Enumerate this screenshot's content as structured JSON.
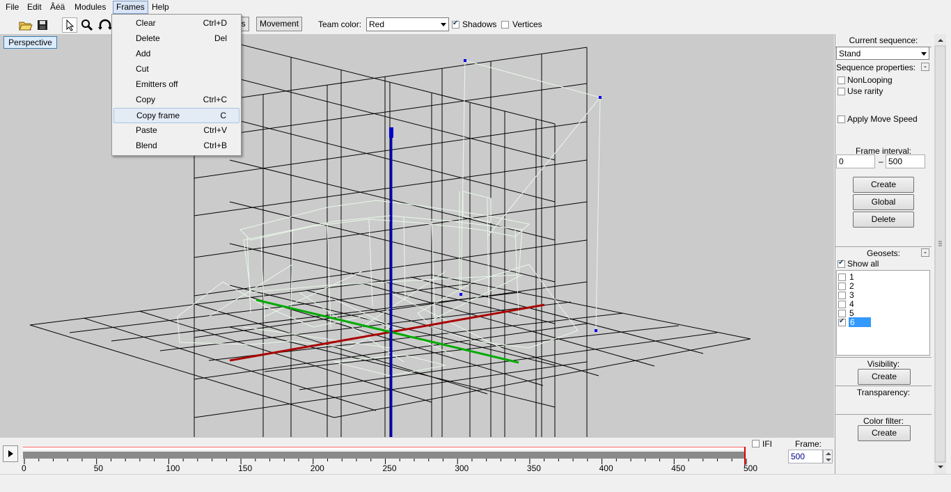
{
  "menubar": {
    "items": [
      "File",
      "Edit",
      "Âéä",
      "Modules",
      "Frames",
      "Help"
    ]
  },
  "toolbar": {
    "tab_partial": "ns",
    "tab_movement": "Movement",
    "team_color_label": "Team color:",
    "team_color_value": "Red",
    "shadows_label": "Shadows",
    "shadows_checked": true,
    "vertices_label": "Vertices",
    "vertices_checked": false
  },
  "frames_menu": {
    "items": [
      {
        "label": "Clear",
        "shortcut": "Ctrl+D"
      },
      {
        "label": "Delete",
        "shortcut": "Del"
      },
      {
        "label": "Add",
        "shortcut": ""
      },
      {
        "label": "Cut",
        "shortcut": ""
      },
      {
        "label": "Emitters off",
        "shortcut": ""
      },
      {
        "label": "Copy",
        "shortcut": "Ctrl+C"
      },
      {
        "label": "Copy frame",
        "shortcut": "C"
      },
      {
        "label": "Paste",
        "shortcut": "Ctrl+V"
      },
      {
        "label": "Blend",
        "shortcut": "Ctrl+B"
      }
    ],
    "highlighted_index": 6
  },
  "viewport": {
    "view_button": "Perspective"
  },
  "timeline": {
    "ticks": [
      "0",
      "50",
      "100",
      "150",
      "200",
      "250",
      "300",
      "350",
      "400",
      "450",
      "500"
    ],
    "ifi_label": "IFI",
    "frame_label": "Frame:",
    "frame_value": "500"
  },
  "right_panel": {
    "current_sequence_label": "Current sequence:",
    "sequence_value": "Stand",
    "sequence_properties_label": "Sequence properties:",
    "nonlooping_label": "NonLooping",
    "use_rarity_label": "Use rarity",
    "apply_move_speed_label": "Apply Move Speed",
    "frame_interval_label": "Frame interval:",
    "interval_start": "0",
    "interval_dash": "–",
    "interval_end": "500",
    "create_label": "Create",
    "global_label": "Global",
    "delete_label": "Delete",
    "geosets_label": "Geosets:",
    "show_all_label": "Show all",
    "geosets": [
      "1",
      "2",
      "3",
      "4",
      "5",
      "6"
    ],
    "geoset_selected": "6",
    "visibility_label": "Visibility:",
    "visibility_create": "Create",
    "transparency_label": "Transparency:",
    "color_filter_label": "Color filter:",
    "color_filter_create": "Create",
    "collapse_glyph": "-"
  },
  "colors": {
    "viewport_bg": "#cbcbcb",
    "grid": "#000000",
    "x_axis": "#aa0000",
    "y_axis": "#00aa00",
    "z_axis": "#0000cc",
    "mesh": "#e8f8e8",
    "selection": "#2b6fd6"
  }
}
